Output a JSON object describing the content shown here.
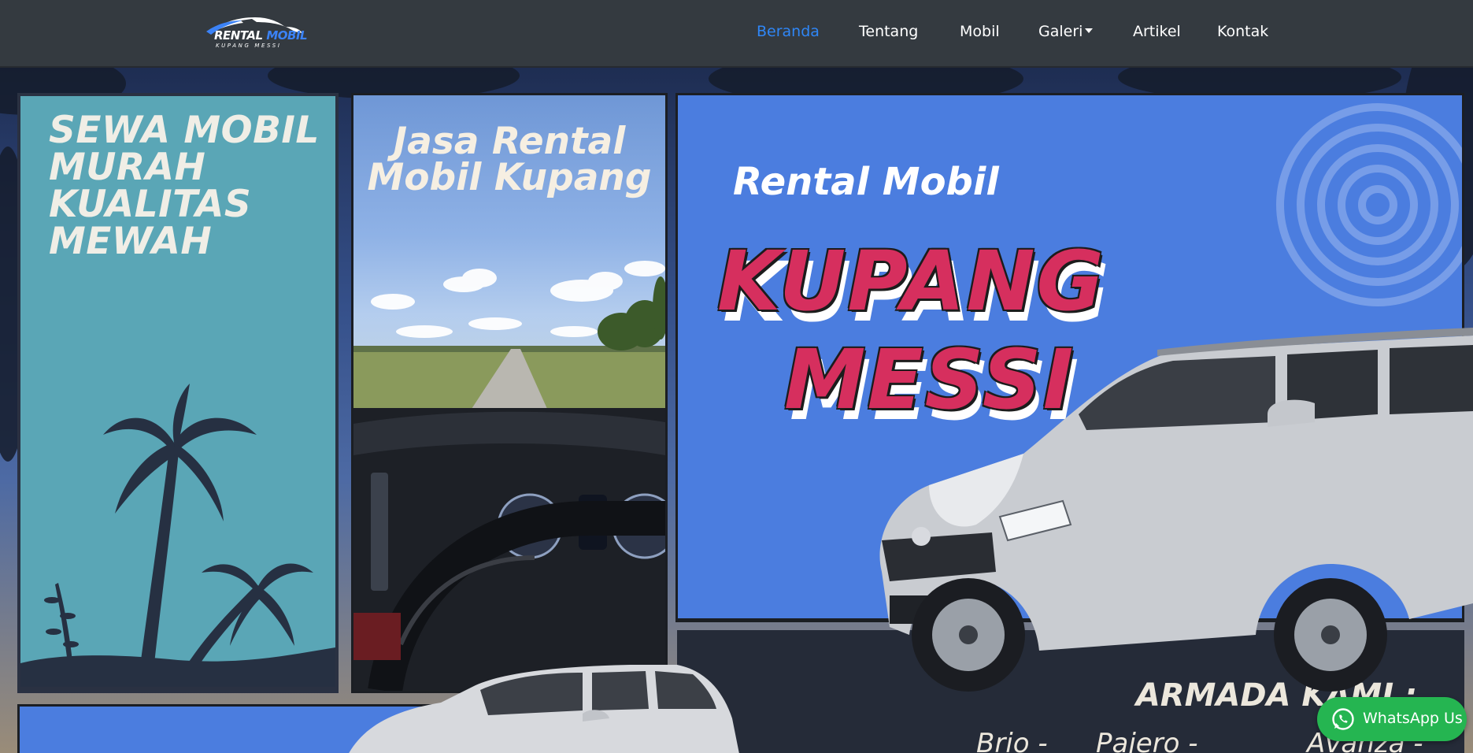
{
  "brand": {
    "logo_main_a": "RENTAL",
    "logo_main_b": "MOBIL",
    "logo_sub": "KUPANG MESSI"
  },
  "nav": {
    "items": [
      {
        "label": "Beranda",
        "active": true
      },
      {
        "label": "Tentang",
        "active": false
      },
      {
        "label": "Mobil",
        "active": false
      },
      {
        "label": "Galeri",
        "active": false,
        "dropdown": true
      },
      {
        "label": "Artikel",
        "active": false
      },
      {
        "label": "Kontak",
        "active": false
      }
    ]
  },
  "hero": {
    "panel1_lines": [
      "SEWA MOBIL",
      "MURAH",
      "KUALITAS",
      "MEWAH"
    ],
    "panel2_lines": [
      "Jasa Rental",
      "Mobil Kupang"
    ],
    "panel3_small": "Rental Mobil",
    "panel3_big_1": "KUPANG",
    "panel3_big_2": "MESSI",
    "armada_title": "ARMADA KAMI :",
    "armada_models": [
      "Brio -",
      "Pajero -",
      "Avanza -"
    ]
  },
  "whatsapp": {
    "label": "WhatsApp Us",
    "icon": "whatsapp-icon",
    "color": "#25b551"
  },
  "colors": {
    "nav_bg": "#343a40",
    "nav_active": "#2f86f6",
    "panel_teal": "#5aa6b6",
    "panel_blue": "#4b7ddf",
    "brand_pink": "#d62f5e"
  }
}
